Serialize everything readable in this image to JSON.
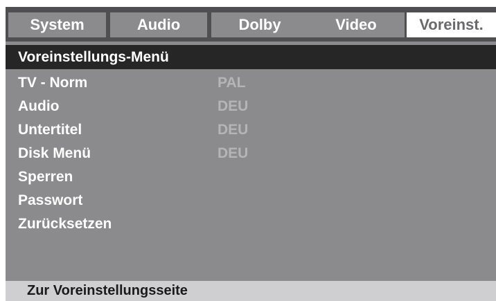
{
  "tabs": [
    {
      "label": "System",
      "active": false
    },
    {
      "label": "Audio",
      "active": false
    },
    {
      "label": "Dolby",
      "active": false
    },
    {
      "label": "Video",
      "active": false
    },
    {
      "label": "Voreinst.",
      "active": true
    }
  ],
  "menu": {
    "title": "Voreinstellungs-Menü",
    "items": [
      {
        "label": "TV - Norm",
        "value": "PAL"
      },
      {
        "label": "Audio",
        "value": "DEU"
      },
      {
        "label": "Untertitel",
        "value": "DEU"
      },
      {
        "label": "Disk Menü",
        "value": "DEU"
      },
      {
        "label": "Sperren",
        "value": ""
      },
      {
        "label": "Passwort",
        "value": ""
      },
      {
        "label": "Zurücksetzen",
        "value": ""
      }
    ]
  },
  "hint": "Zur Voreinstellungsseite",
  "colors": {
    "background": "#8b8b8d",
    "tabbar": "#4f4f51",
    "title_bar": "#262626",
    "active_tab": "#ffffff",
    "value_text": "#b5b5b7",
    "hint_bar": "#cfcfd1"
  }
}
